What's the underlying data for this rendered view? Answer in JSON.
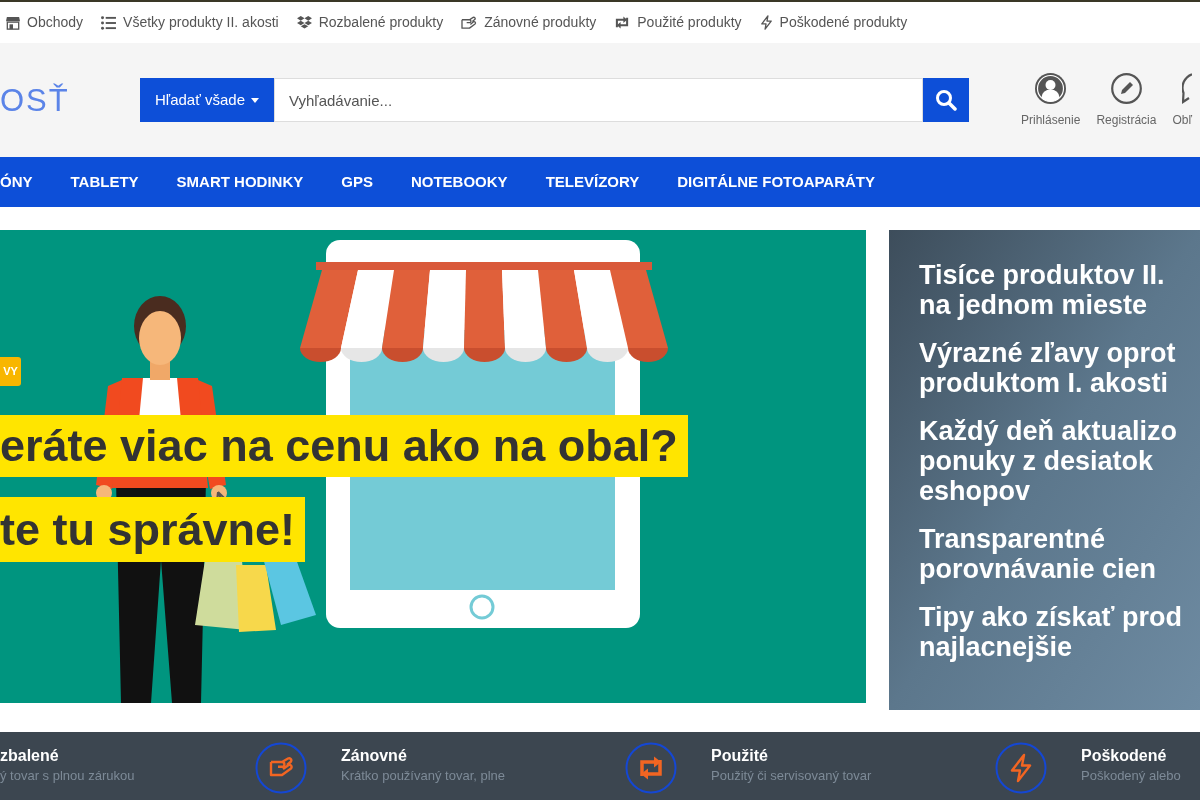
{
  "top_links": [
    "Obchody",
    "Všetky produkty II. akosti",
    "Rozbalené produkty",
    "Zánovné produkty",
    "Použité produkty",
    "Poškodené produkty"
  ],
  "header": {
    "logo": "OSŤ",
    "search": {
      "scope": "Hľadať všade",
      "placeholder": "Vyhľadávanie..."
    },
    "account_links": [
      "Prihlásenie",
      "Registrácia",
      "Obľ"
    ]
  },
  "nav": [
    "ÓNY",
    "TABLETY",
    "SMART HODINKY",
    "GPS",
    "NOTEBOOKY",
    "TELEVÍZORY",
    "DIGITÁLNE FOTOAPARÁTY"
  ],
  "banner": {
    "badge": "VY",
    "headlines": [
      "eráte viac na cenu ako na obal?",
      "te tu správne!"
    ]
  },
  "benefits": [
    {
      "lines": [
        "Tisíce produktov II.",
        "na jednom mieste"
      ]
    },
    {
      "lines": [
        "Výrazné zľavy oprot",
        "produktom I. akosti"
      ]
    },
    {
      "lines": [
        "Každý deň aktualizo",
        "ponuky z desiatok",
        "eshopov"
      ]
    },
    {
      "lines": [
        "Transparentné",
        "porovnávanie cien"
      ]
    },
    {
      "lines": [
        "Tipy ako získať prod",
        "najlacnejšie"
      ]
    }
  ],
  "categories": [
    {
      "kind": "text",
      "title": "zbalené",
      "description": "ý tovar s plnou zárukou"
    },
    {
      "kind": "icon",
      "title": "Zánovné",
      "description": "Krátko používaný tovar, plne"
    },
    {
      "kind": "icon",
      "title": "Použité",
      "description": "Použitý či servisovaný tovar"
    },
    {
      "kind": "icon",
      "title": "Poškodené",
      "description": "Poškodený alebo"
    }
  ]
}
